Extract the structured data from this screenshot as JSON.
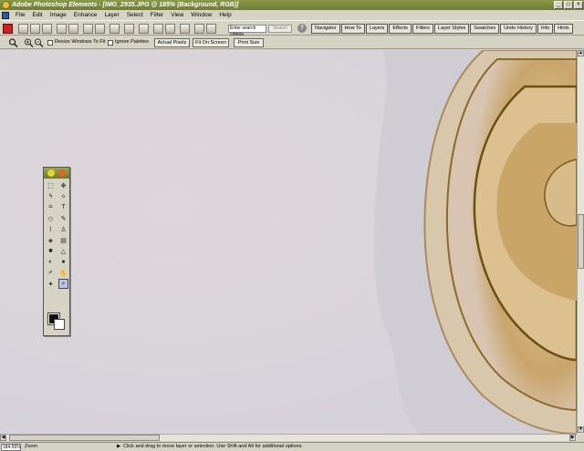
{
  "window": {
    "title": "Adobe Photoshop Elements - [IMG_2935.JPG @ 185% (Background, RGB)]",
    "controls": [
      "_",
      "□",
      "×"
    ]
  },
  "menu": [
    "File",
    "Edit",
    "Image",
    "Enhance",
    "Layer",
    "Select",
    "Filter",
    "View",
    "Window",
    "Help"
  ],
  "shortcuts": {
    "search_placeholder": "Enter search criteria",
    "search_button": "Search",
    "help_label": "?"
  },
  "palette_tabs": [
    "Navigator",
    "How To",
    "Layers",
    "Effects",
    "Filters",
    "Layer Styles",
    "Swatches",
    "Undo History",
    "Info",
    "Hints"
  ],
  "options": {
    "resize_label": "Resize Windows To Fit",
    "ignore_label": "Ignore Palettes",
    "actual_pixels": "Actual Pixels",
    "fit_on_screen": "Fit On Screen",
    "print_size": "Print Size"
  },
  "toolbox": {
    "tools": [
      {
        "name": "marquee-tool",
        "glyph": "⬚"
      },
      {
        "name": "move-tool",
        "glyph": "✥"
      },
      {
        "name": "lasso-tool",
        "glyph": "ϟ"
      },
      {
        "name": "magic-wand-tool",
        "glyph": "✧"
      },
      {
        "name": "crop-tool",
        "glyph": "⌗"
      },
      {
        "name": "type-tool",
        "glyph": "T"
      },
      {
        "name": "eraser-tool",
        "glyph": "◇"
      },
      {
        "name": "pencil-tool",
        "glyph": "✎"
      },
      {
        "name": "brush-tool",
        "glyph": "⌇"
      },
      {
        "name": "stamp-tool",
        "glyph": "♙"
      },
      {
        "name": "paint-bucket-tool",
        "glyph": "◈"
      },
      {
        "name": "gradient-tool",
        "glyph": "▤"
      },
      {
        "name": "shape-tool",
        "glyph": "■"
      },
      {
        "name": "blur-tool",
        "glyph": "△"
      },
      {
        "name": "sponge-tool",
        "glyph": "◐"
      },
      {
        "name": "dodge-tool",
        "glyph": "●"
      },
      {
        "name": "eyedropper-tool",
        "glyph": "⌿"
      },
      {
        "name": "hand-tool",
        "glyph": "✋"
      },
      {
        "name": "zoom-tool-2",
        "glyph": "✦"
      },
      {
        "name": "zoom-tool",
        "glyph": "⌕"
      }
    ]
  },
  "status": {
    "zoom": "184.55%",
    "doc_label": "Zoom",
    "hint": "Click and drag to move layer or selection. Use Shift and Alt for additional options."
  }
}
